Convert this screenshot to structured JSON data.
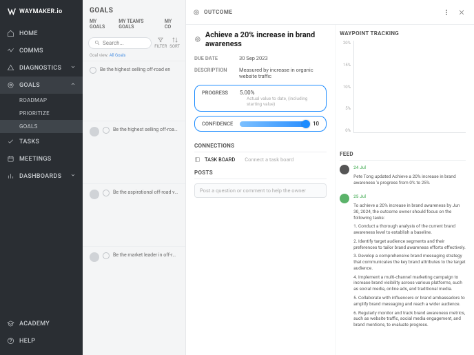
{
  "brand": "WAYMAKER.io",
  "nav": {
    "home": "HOME",
    "comms": "COMMS",
    "diagnostics": "DIAGNOSTICS",
    "goals": "GOALS",
    "roadmap": "ROADMAP",
    "prioritize": "PRIORITIZE",
    "goals_sub": "GOALS",
    "tasks": "TASKS",
    "meetings": "MEETINGS",
    "dashboards": "DASHBOARDS",
    "academy": "ACADEMY",
    "help": "HELP"
  },
  "mid": {
    "title": "GOALS",
    "tabs": {
      "my": "MY GOALS",
      "team": "MY TEAM'S GOALS",
      "company": "MY CO"
    },
    "search_placeholder": "Search...",
    "filter": "FILTER",
    "sort": "SORT",
    "crumb_label": "Goal view:",
    "crumb_link": "All Goals",
    "items": [
      "Be the highest selling off-road en",
      "Be the highest selling off-road el",
      "Be the aspirational off-road vehi for families",
      "Be the market leader in off-road"
    ]
  },
  "panel": {
    "tag": "OUTCOME",
    "title": "Achieve a 20% increase in brand awareness",
    "due_label": "DUE DATE",
    "due_value": "30 Sep 2023",
    "desc_label": "DESCRIPTION",
    "desc_value": "Measured by increase in organic website traffic",
    "progress_label": "PROGRESS",
    "progress_value": "5.00%",
    "progress_hint": "Actual value to date, (including starting value)",
    "confidence_label": "CONFIDENCE",
    "confidence_value": "10",
    "connections": "CONNECTIONS",
    "taskboard": "TASK BOARD",
    "taskboard_link": "Connect a task board",
    "posts": "POSTS",
    "post_placeholder": "Post a question or comment to help the owner"
  },
  "side": {
    "tracking": "WAYPOINT TRACKING",
    "feed": "FEED",
    "feed1": {
      "date": "24 Jul",
      "text": "Pete Tong updated Achieve a 20% increase in brand awareness 's progress from 0% to 25%"
    },
    "feed2": {
      "date": "25 Jul",
      "intro": "To achieve a 20% increase in brand awareness by Jun 30, 2024, the outcome owner should focus on the following tasks:",
      "p1": "1. Conduct a thorough analysis of the current brand awareness level to establish a baseline.",
      "p2": "2. Identify target audience segments and their preferences to tailor brand awareness efforts effectively.",
      "p3": "3. Develop a comprehensive brand messaging strategy that communicates the key brand attributes to the target audience.",
      "p4": "4. Implement a multi-channel marketing campaign to increase brand visibility across various platforms, such as social media, online ads, and traditional media.",
      "p5": "5. Collaborate with influencers or brand ambassadors to amplify brand messaging and reach a wider audience.",
      "p6": "6. Regularly monitor and track brand awareness metrics, such as website traffic, social media engagement, and brand mentions, to evaluate progress."
    }
  },
  "chart_data": {
    "type": "line",
    "title": "Waypoint Tracking",
    "ylabel": "%",
    "ylim": [
      0,
      20
    ],
    "yticks": [
      0,
      5,
      10,
      15,
      20
    ],
    "series": [],
    "note": "No data points plotted"
  }
}
